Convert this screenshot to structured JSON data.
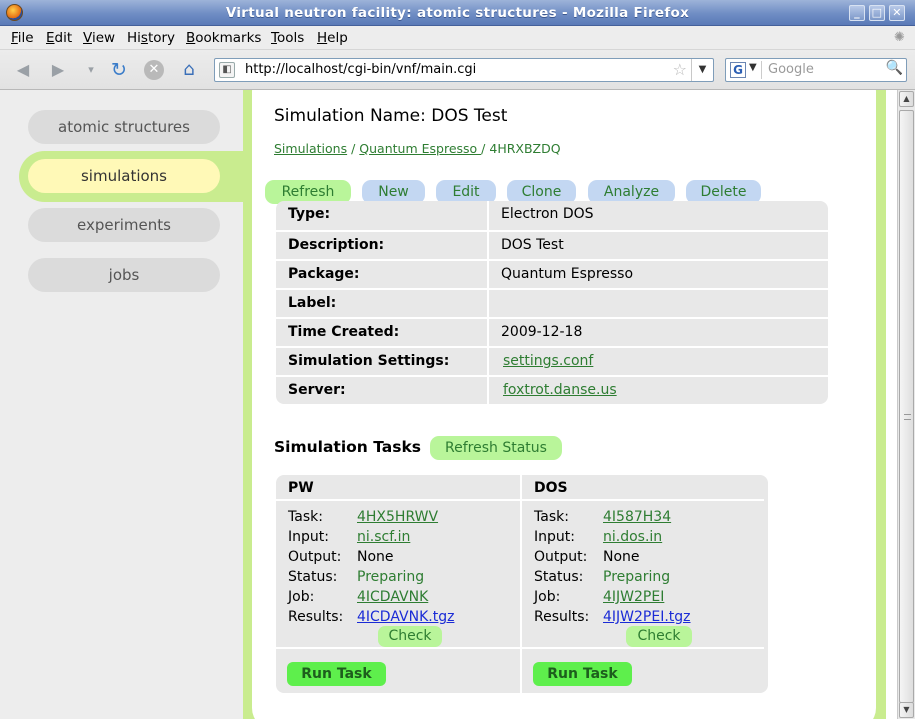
{
  "window": {
    "title": "Virtual neutron facility: atomic structures - Mozilla Firefox",
    "minimize": "_",
    "maximize": "□",
    "close": "✕"
  },
  "menu": [
    "File",
    "Edit",
    "View",
    "History",
    "Bookmarks",
    "Tools",
    "Help"
  ],
  "menu_access_keys": [
    "F",
    "E",
    "V",
    "s",
    "B",
    "T",
    "H"
  ],
  "navbar": {
    "url": "http://localhost/cgi-bin/vnf/main.cgi",
    "search_placeholder": "Google",
    "search_engine": "G"
  },
  "sidebar": {
    "items": [
      {
        "label": "atomic structures",
        "active": false
      },
      {
        "label": "simulations",
        "active": true
      },
      {
        "label": "experiments",
        "active": false
      },
      {
        "label": "jobs",
        "active": false
      }
    ]
  },
  "simulation": {
    "title": "Simulation Name: DOS Test",
    "breadcrumb": [
      {
        "label": "Simulations",
        "link": true
      },
      {
        "label": "Quantum Espresso ",
        "link": true
      },
      {
        "label": "4HRXBZDQ",
        "link": false
      }
    ],
    "breadcrumb_separator": "/",
    "actions": [
      "Refresh",
      "New",
      "Edit",
      "Clone",
      "Analyze",
      "Delete"
    ],
    "info": [
      {
        "key": "Type:",
        "value": "Electron DOS",
        "link": false
      },
      {
        "key": "Description:",
        "value": "DOS Test",
        "link": false
      },
      {
        "key": "Package:",
        "value": "Quantum Espresso",
        "link": false
      },
      {
        "key": "Label:",
        "value": "",
        "link": false
      },
      {
        "key": "Time Created:",
        "value": "2009-12-18",
        "link": false
      },
      {
        "key": "Simulation Settings:",
        "value": "settings.conf",
        "link": true
      },
      {
        "key": "Server:",
        "value": "foxtrot.danse.us",
        "link": true
      }
    ]
  },
  "tasks": {
    "heading": "Simulation Tasks",
    "refresh_status": "Refresh Status",
    "field_labels": {
      "task": "Task:",
      "input": "Input:",
      "output": "Output:",
      "status": "Status:",
      "job": "Job:",
      "results": "Results:"
    },
    "check_label": "Check",
    "run_label": "Run Task",
    "columns": [
      {
        "name": "PW",
        "task": "4HX5HRWV",
        "input": "ni.scf.in",
        "output": "None",
        "status": "Preparing",
        "job": "4ICDAVNK",
        "results": "4ICDAVNK.tgz"
      },
      {
        "name": "DOS",
        "task": "4I587H34",
        "input": "ni.dos.in",
        "output": "None",
        "status": "Preparing",
        "job": "4IJW2PEI",
        "results": "4IJW2PEI.tgz"
      }
    ]
  },
  "colors": {
    "frame_green": "#c9ec8f",
    "link_green": "#2e7d32",
    "results_link_blue": "#1a2bd6",
    "active_nav": "#fff9b7"
  }
}
